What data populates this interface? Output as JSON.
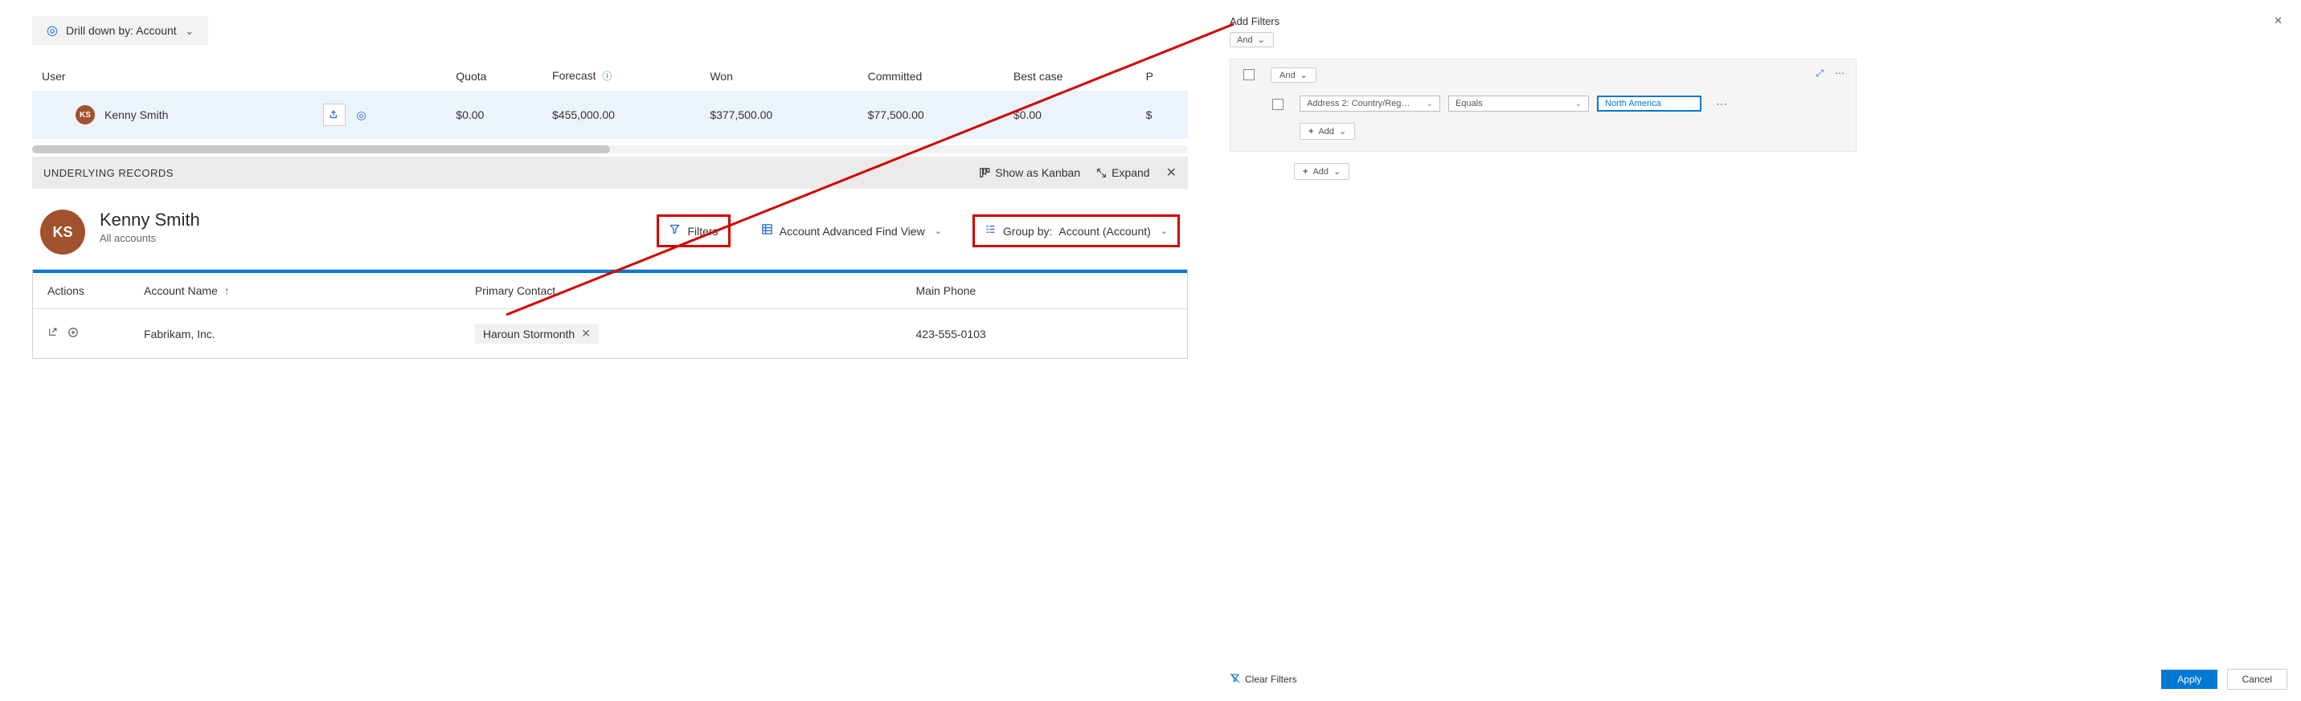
{
  "drilldown": {
    "label": "Drill down by: Account"
  },
  "forecast": {
    "headers": {
      "user": "User",
      "quota": "Quota",
      "forecast": "Forecast",
      "won": "Won",
      "committed": "Committed",
      "bestcase": "Best case",
      "pipeline_initial": "P"
    },
    "row": {
      "user": "Kenny Smith",
      "avatar_initials": "KS",
      "quota": "$0.00",
      "forecast": "$455,000.00",
      "won": "$377,500.00",
      "committed": "$77,500.00",
      "bestcase": "$0.00",
      "pipeline": "$"
    }
  },
  "section": {
    "title": "UNDERLYING RECORDS",
    "kanban_label": "Show as Kanban",
    "expand_label": "Expand"
  },
  "detail": {
    "avatar_initials": "KS",
    "name": "Kenny Smith",
    "subtitle": "All accounts",
    "toolbar": {
      "filters": "Filters",
      "view": "Account Advanced Find View",
      "groupby_prefix": "Group by:  ",
      "groupby_value": "Account (Account)"
    }
  },
  "grid": {
    "headers": {
      "actions": "Actions",
      "account_name": "Account Name",
      "primary_contact": "Primary Contact",
      "main_phone": "Main Phone"
    },
    "row": {
      "account_name": "Fabrikam, Inc.",
      "primary_contact": "Haroun Stormonth",
      "main_phone": "423-555-0103"
    }
  },
  "filters_panel": {
    "title": "Add Filters",
    "operator": "And",
    "group_operator": "And",
    "row": {
      "field": "Address 2: Country/Reg…",
      "op": "Equals",
      "value": "North America"
    },
    "add_label": "Add",
    "clear_label": "Clear Filters",
    "apply": "Apply",
    "cancel": "Cancel"
  }
}
